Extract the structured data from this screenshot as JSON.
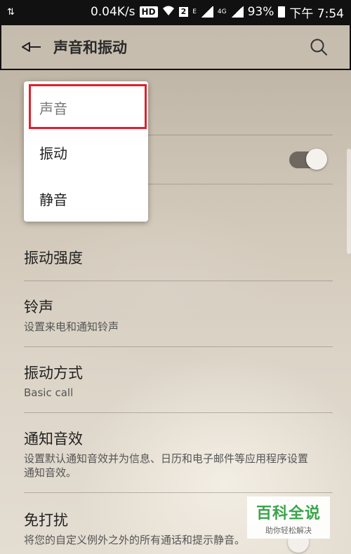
{
  "status_bar": {
    "net_speed": "0.04K/s",
    "hd": "HD",
    "sim": "2",
    "e_label": "E",
    "net_4g": "4G",
    "battery": "93%",
    "time": "下午 7:54"
  },
  "header": {
    "title": "声音和振动"
  },
  "settings": {
    "vibration_strength": "振动强度",
    "ringtone": {
      "title": "铃声",
      "subtitle": "设置来电和通知铃声"
    },
    "vibration_pattern": {
      "title": "振动方式",
      "subtitle": "Basic call"
    },
    "notification_sound": {
      "title": "通知音效",
      "subtitle": "设置默认通知音效并为信息、日历和电子邮件等应用程序设置通知音效。"
    },
    "do_not_disturb": {
      "title": "免打扰",
      "subtitle": "将您的自定义例外之外的所有通话和提示静音。"
    }
  },
  "popup": {
    "options": [
      "声音",
      "振动",
      "静音"
    ],
    "selected": "声音"
  },
  "watermark": {
    "main": "百科全说",
    "sub": "助你轻松解决"
  },
  "colors": {
    "highlight": "#e0202a",
    "watermark_green": "#3aa44a"
  }
}
